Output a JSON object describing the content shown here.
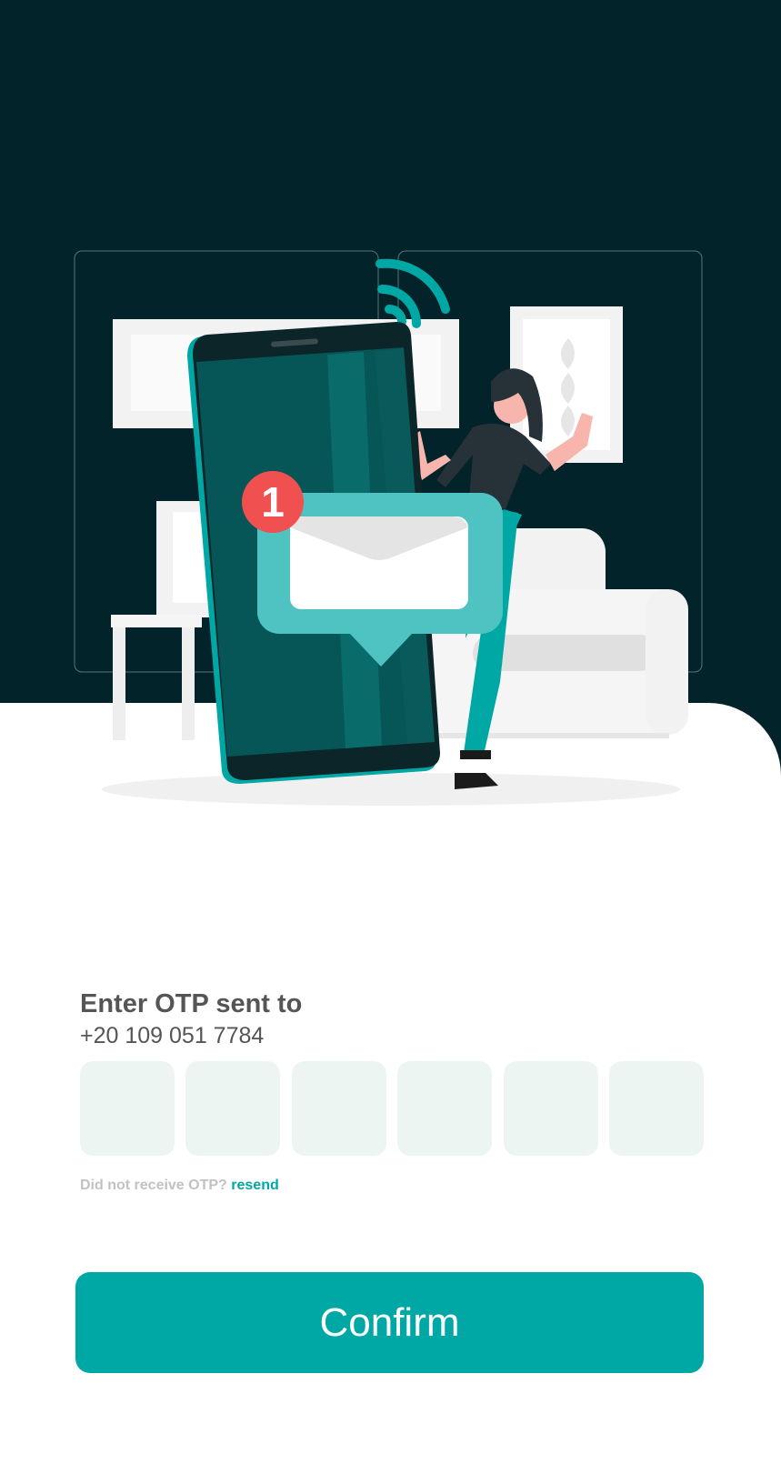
{
  "illustration": {
    "notification_badge": "1"
  },
  "otp": {
    "title": "Enter OTP sent to",
    "phone": "+20 109 051 7784",
    "digits": [
      "",
      "",
      "",
      "",
      "",
      ""
    ]
  },
  "resend": {
    "prompt": "Did not receive OTP?",
    "link": "resend"
  },
  "confirm": {
    "label": "Confirm"
  },
  "colors": {
    "hero_background": "#03232b",
    "accent": "#00a8a5",
    "otp_box_fill": "#edf5f3",
    "badge": "#f0504f"
  }
}
